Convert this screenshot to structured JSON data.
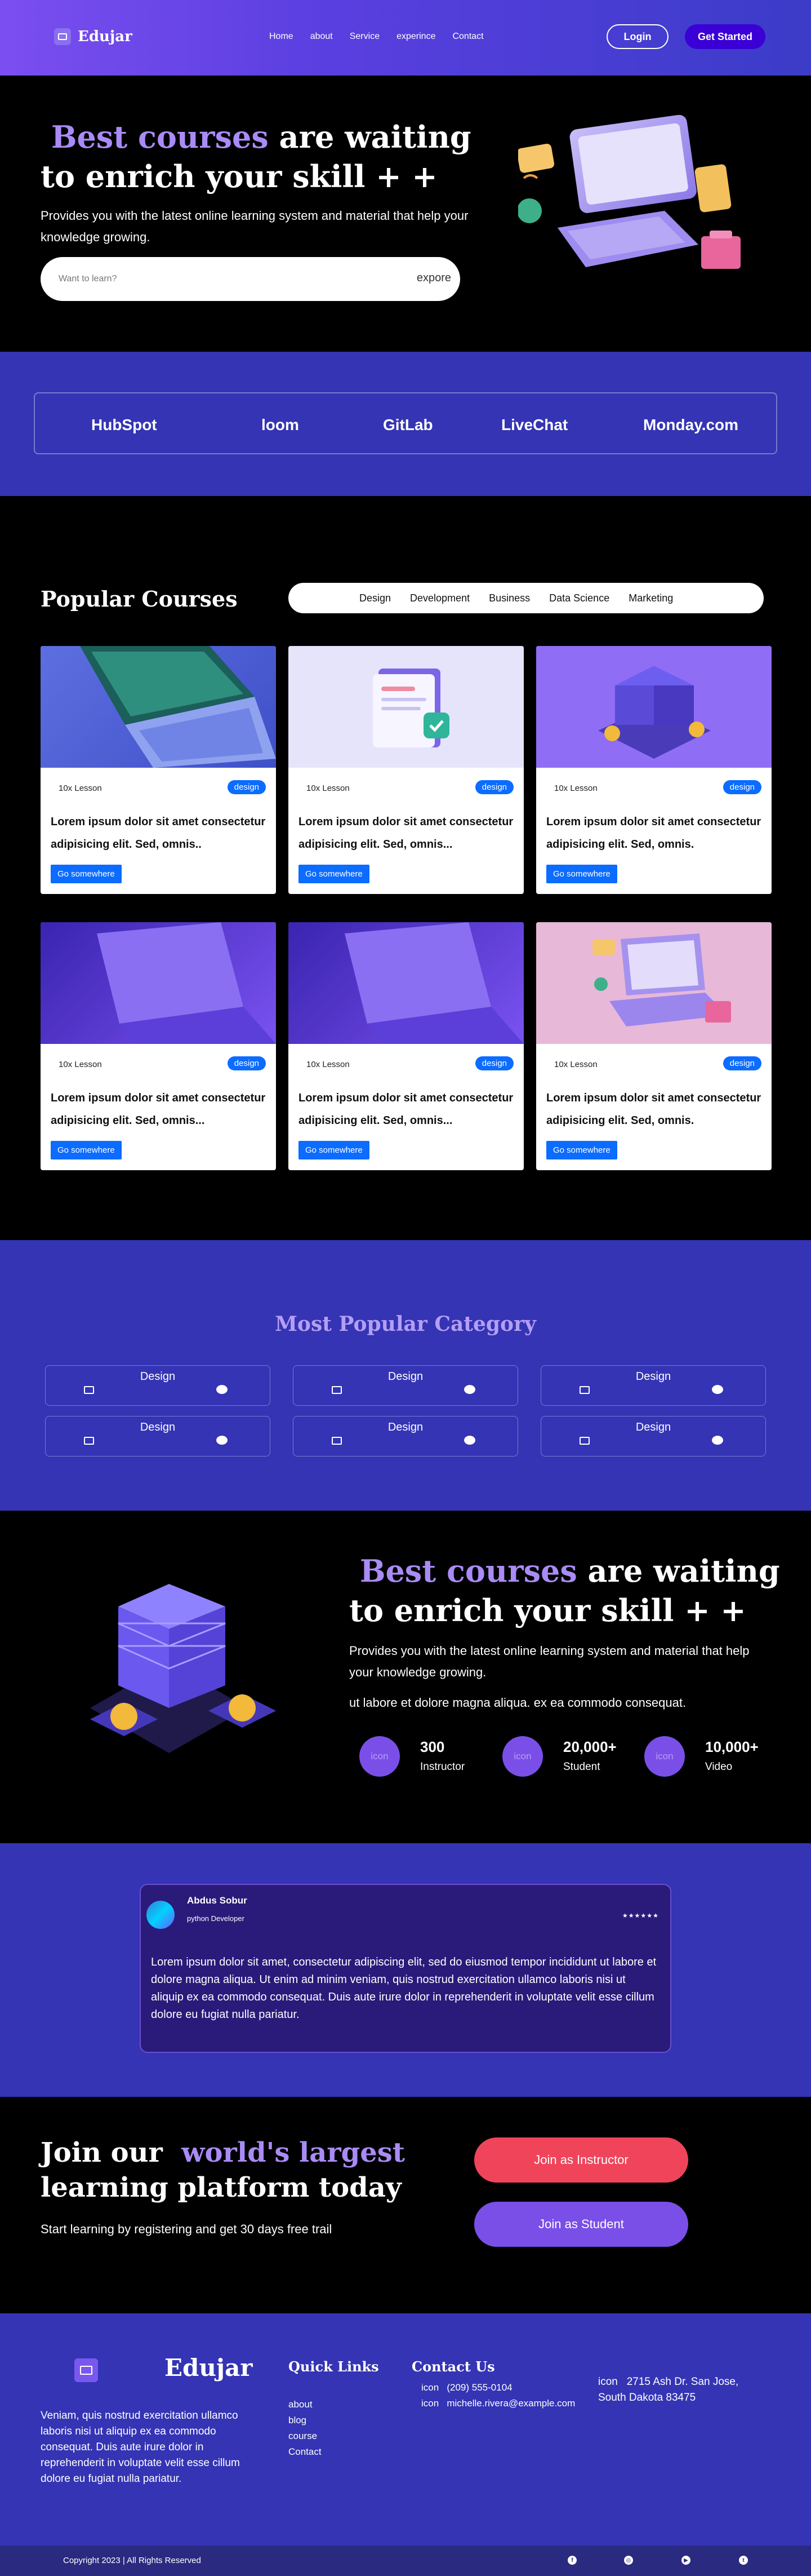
{
  "nav": {
    "brand": "Edujar",
    "links": [
      "Home",
      "about",
      "Service",
      "experince",
      "Contact"
    ],
    "login": "Login",
    "get_started": "Get Started"
  },
  "hero": {
    "accent": "Best courses",
    "title_rest": " are waiting to enrich your skill + +",
    "subtitle": "Provides you with the latest online learning system and material that help your knowledge growing.",
    "search_placeholder": "Want to learn?",
    "explore": "expore"
  },
  "brands": [
    "HubSpot",
    "loom",
    "GitLab",
    "LiveChat",
    "Monday.com"
  ],
  "courses": {
    "heading": "Popular Courses",
    "filters": [
      "Design",
      "Development",
      "Business",
      "Data Science",
      "Marketing"
    ],
    "cards": [
      {
        "lesson": "10x Lesson",
        "tag": "design",
        "title": "Lorem ipsum dolor sit amet consectetur adipisicing elit. Sed, omnis..",
        "button": "Go somewhere"
      },
      {
        "lesson": "10x Lesson",
        "tag": "design",
        "title": "Lorem ipsum dolor sit amet consectetur adipisicing elit. Sed, omnis...",
        "button": "Go somewhere"
      },
      {
        "lesson": "10x Lesson",
        "tag": "design",
        "title": "Lorem ipsum dolor sit amet consectetur adipisicing elit. Sed, omnis.",
        "button": "Go somewhere"
      },
      {
        "lesson": "10x Lesson",
        "tag": "design",
        "title": "Lorem ipsum dolor sit amet consectetur adipisicing elit. Sed, omnis...",
        "button": "Go somewhere"
      },
      {
        "lesson": "10x Lesson",
        "tag": "design",
        "title": "Lorem ipsum dolor sit amet consectetur adipisicing elit. Sed, omnis...",
        "button": "Go somewhere"
      },
      {
        "lesson": "10x Lesson",
        "tag": "design",
        "title": "Lorem ipsum dolor sit amet consectetur adipisicing elit. Sed, omnis.",
        "button": "Go somewhere"
      }
    ]
  },
  "category": {
    "heading": "Most Popular Category",
    "items": [
      "Design",
      "Design",
      "Design",
      "Design",
      "Design",
      "Design"
    ]
  },
  "about": {
    "accent": "Best courses",
    "title_rest": " are waiting to enrich your skill + +",
    "p1": "Provides you with the latest online learning system and material that help your knowledge growing.",
    "p2": "ut labore et dolore magna aliqua. ex ea commodo consequat.",
    "stats": [
      {
        "icon": "icon",
        "num": "300",
        "label": "Instructor"
      },
      {
        "icon": "icon",
        "num": "20,000+",
        "label": "Student"
      },
      {
        "icon": "icon",
        "num": "10,000+",
        "label": "Video"
      }
    ]
  },
  "testimonial": {
    "name": "Abdus Sobur",
    "role": "python Developer",
    "stars": "★★★★★★",
    "quote": "Lorem ipsum dolor sit amet, consectetur adipiscing elit, sed do eiusmod tempor incididunt ut labore et dolore magna aliqua. Ut enim ad minim veniam, quis nostrud exercitation ullamco laboris nisi ut aliquip ex ea commodo consequat. Duis aute irure dolor in reprehenderit in voluptate velit esse cillum dolore eu fugiat nulla pariatur."
  },
  "join": {
    "line1": "Join our ",
    "accent": "world's largest",
    "line2": "learning platform today",
    "subtitle": "Start learning by registering and get 30 days free trail",
    "instructor": "Join as Instructor",
    "student": "Join as Student"
  },
  "footer": {
    "brand": "Edujar",
    "desc": "Veniam, quis nostrud exercitation ullamco laboris nisi ut aliquip ex ea commodo consequat. Duis aute irure dolor in reprehenderit in voluptate velit esse cillum dolore eu fugiat nulla pariatur.",
    "quick_heading": "Quick Links",
    "quick_links": [
      "about",
      "blog",
      "course",
      "Contact"
    ],
    "contact_heading": "Contact Us",
    "phone_icon": "icon",
    "phone": "(209) 555-0104",
    "email_icon": "icon",
    "email": "michelle.rivera@example.com",
    "addr_icon": "icon",
    "address": "2715 Ash Dr. San Jose, South Dakota 83475",
    "copyright": "Copyright 2023 | All Rights Reserved",
    "socials": [
      "facebook-icon",
      "instagram-icon",
      "youtube-icon",
      "twitter-icon"
    ]
  }
}
